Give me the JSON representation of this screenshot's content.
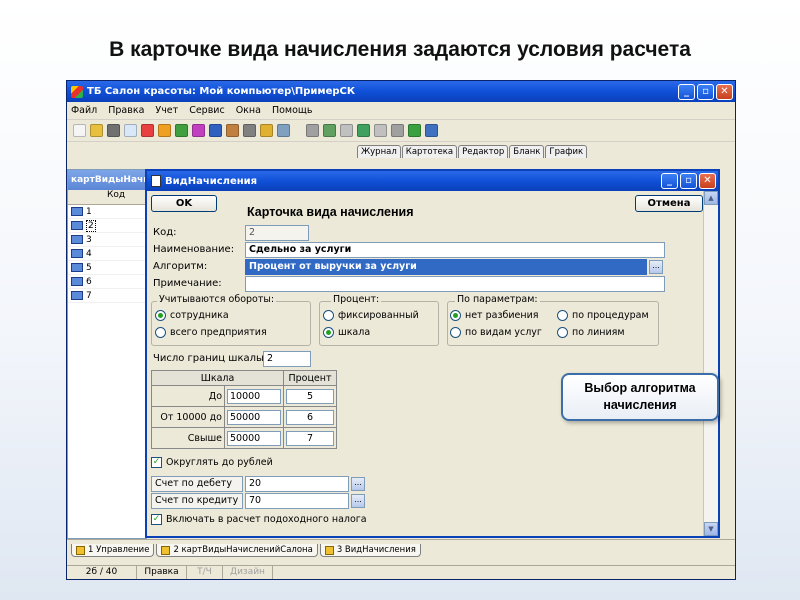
{
  "slide": {
    "title": "В карточке вида начисления задаются условия расчета"
  },
  "app": {
    "title": "ТБ Салон красоты: Мой компьютер\\ПримерСК",
    "controls": {
      "minimize": "_",
      "maximize": "▫",
      "close": "✕"
    },
    "menu": [
      "Файл",
      "Правка",
      "Учет",
      "Сервис",
      "Окна",
      "Помощь"
    ],
    "toolbar_tabs": [
      "Журнал",
      "Картотека",
      "Редактор",
      "Бланк",
      "График"
    ],
    "toolbar_icons": [
      {
        "name": "new-icon",
        "color": "#f5f5f5"
      },
      {
        "name": "open-icon",
        "color": "#e8c040"
      },
      {
        "name": "print-icon",
        "color": "#707070"
      },
      {
        "name": "copy-icon",
        "color": "#d8e8f8"
      },
      {
        "name": "report-icon",
        "color": "#e84040"
      },
      {
        "name": "chart-icon",
        "color": "#f0a020"
      },
      {
        "name": "filter-icon",
        "color": "#40a040"
      },
      {
        "name": "sort-icon",
        "color": "#c040c0"
      },
      {
        "name": "book-icon",
        "color": "#3060c0"
      },
      {
        "name": "home-icon",
        "color": "#c08040"
      },
      {
        "name": "tools-icon",
        "color": "#808080"
      },
      {
        "name": "bag-icon",
        "color": "#e0b030"
      },
      {
        "name": "calc-icon",
        "color": "#80a0c0"
      }
    ],
    "toolbar_icons_2": [
      {
        "name": "edit-icon",
        "color": "#a0a0a0"
      },
      {
        "name": "arrow-in-icon",
        "color": "#60a060"
      },
      {
        "name": "arrow-out-icon",
        "color": "#c0c0c0"
      },
      {
        "name": "move-icon",
        "color": "#40a060"
      },
      {
        "name": "delete-icon",
        "color": "#c0c0c0"
      },
      {
        "name": "refresh-icon",
        "color": "#a0a0a0"
      },
      {
        "name": "check-icon",
        "color": "#3aa040"
      },
      {
        "name": "group-icon",
        "color": "#4070c0"
      }
    ]
  },
  "listwin": {
    "title": "картВидыНачисле",
    "header": "Код",
    "rows": [
      "1",
      "2",
      "3",
      "4",
      "5",
      "6",
      "7"
    ]
  },
  "dialog": {
    "title": "ВидНачисления",
    "ok": "OK",
    "cancel": "Отмена",
    "card_title": "Карточка вида начисления",
    "code_label": "Код:",
    "code_value": "2",
    "name_label": "Наименование:",
    "name_value": "Сдельно за услуги",
    "algo_label": "Алгоритм:",
    "algo_value": "Процент от выручки за услуги",
    "note_label": "Примечание:",
    "ellipsis": "...",
    "turnover": {
      "legend": "Учитываются  обороты:",
      "options": [
        {
          "label": "сотрудника",
          "checked": true
        },
        {
          "label": "всего предприятия",
          "checked": false
        }
      ]
    },
    "percent": {
      "legend": "Процент:",
      "options": [
        {
          "label": "фиксированный",
          "checked": false
        },
        {
          "label": "шкала",
          "checked": true
        }
      ]
    },
    "params": {
      "legend": "По параметрам:",
      "options": [
        {
          "label": "нет разбиения",
          "checked": true
        },
        {
          "label": "по процедурам",
          "checked": false
        },
        {
          "label": "по видам услуг",
          "checked": false
        },
        {
          "label": "по линиям",
          "checked": false
        }
      ]
    },
    "scale_count_label": "Число границ шкалы:",
    "scale_count_value": "2",
    "scale_table": {
      "headers": [
        "Шкала",
        "Процент"
      ],
      "rows": [
        {
          "label": "До",
          "value": "10000",
          "percent": "5"
        },
        {
          "label": "От 10000 до",
          "value": "50000",
          "percent": "6"
        },
        {
          "label": "Свыше",
          "value": "50000",
          "percent": "7"
        }
      ]
    },
    "round_label": "Округлять до рублей",
    "round_checked": true,
    "debit_label": "Счет по дебету",
    "debit_value": "20",
    "credit_label": "Счет по кредиту",
    "credit_value": "70",
    "tax_label": "Включать в расчет подоходного налога",
    "tax_checked": true,
    "scroll_up": "▲",
    "scroll_down": "▼"
  },
  "callout": {
    "line1": "Выбор алгоритма",
    "line2": "начисления"
  },
  "window_tabs": [
    "1 Управление",
    "2 картВидыНачисленийСалона",
    "3 ВидНачисления"
  ],
  "status": {
    "position": "2б / 40",
    "mode": "Правка",
    "tch": "Т/Ч",
    "design": "Дизайн"
  }
}
